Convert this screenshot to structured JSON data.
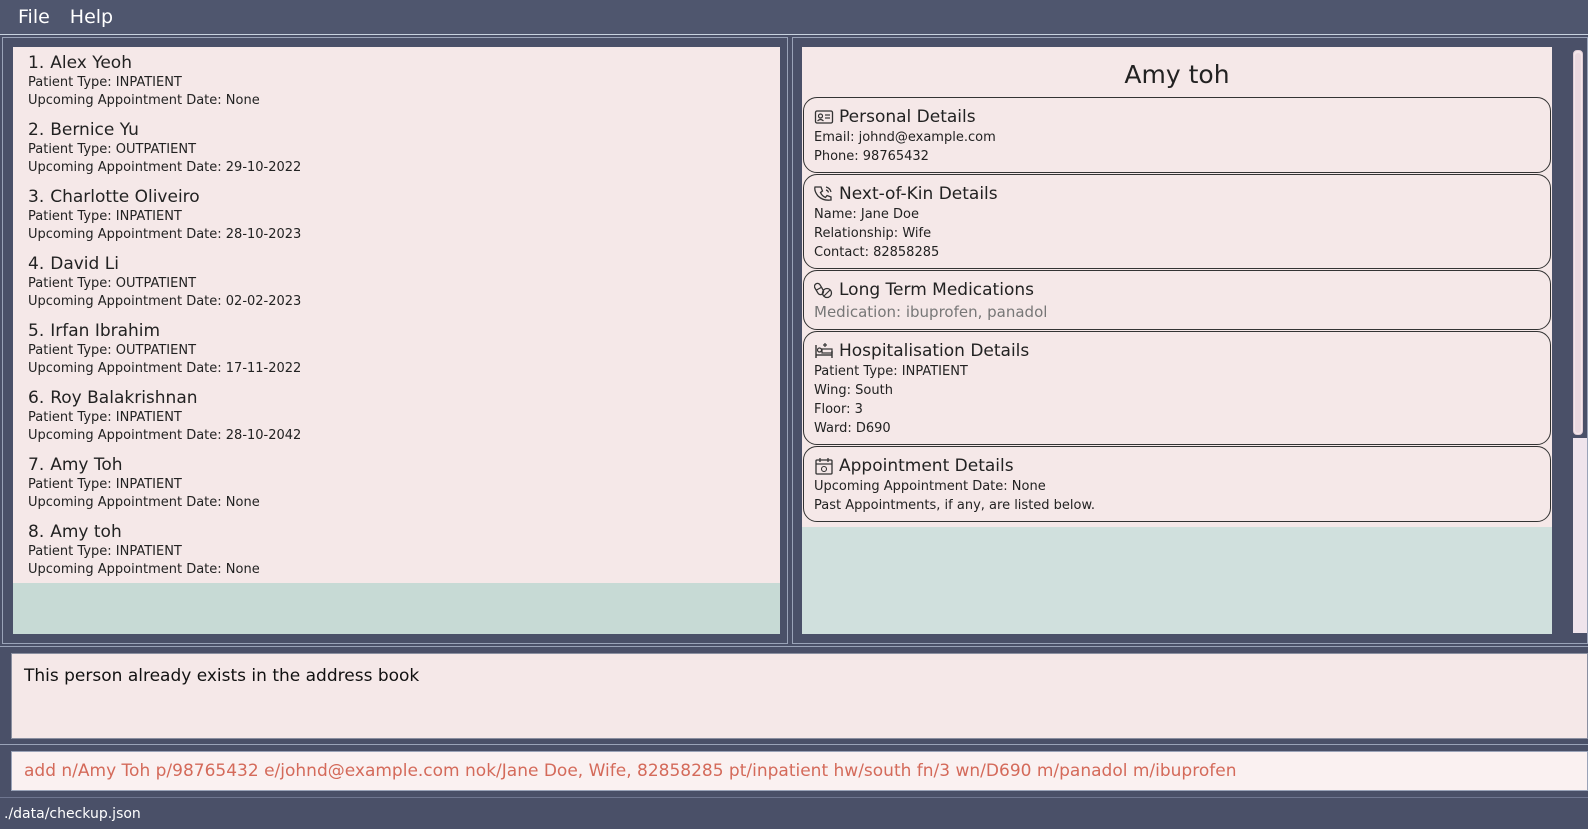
{
  "menu": {
    "file": "File",
    "help": "Help"
  },
  "patients": [
    {
      "index": "1.",
      "name": "Alex Yeoh",
      "type": "Patient Type: INPATIENT",
      "appointment": "Upcoming Appointment Date: None"
    },
    {
      "index": "2.",
      "name": "Bernice Yu",
      "type": "Patient Type: OUTPATIENT",
      "appointment": "Upcoming Appointment Date: 29-10-2022"
    },
    {
      "index": "3.",
      "name": "Charlotte Oliveiro",
      "type": "Patient Type: INPATIENT",
      "appointment": "Upcoming Appointment Date: 28-10-2023"
    },
    {
      "index": "4.",
      "name": "David Li",
      "type": "Patient Type: OUTPATIENT",
      "appointment": "Upcoming Appointment Date: 02-02-2023"
    },
    {
      "index": "5.",
      "name": "Irfan Ibrahim",
      "type": "Patient Type: OUTPATIENT",
      "appointment": "Upcoming Appointment Date: 17-11-2022"
    },
    {
      "index": "6.",
      "name": "Roy Balakrishnan",
      "type": "Patient Type: INPATIENT",
      "appointment": "Upcoming Appointment Date: 28-10-2042"
    },
    {
      "index": "7.",
      "name": "Amy Toh",
      "type": "Patient Type: INPATIENT",
      "appointment": "Upcoming Appointment Date: None"
    },
    {
      "index": "8.",
      "name": "Amy toh",
      "type": "Patient Type: INPATIENT",
      "appointment": "Upcoming Appointment Date: None"
    }
  ],
  "detail": {
    "name": "Amy toh",
    "personal": {
      "title": "Personal Details",
      "email": "Email: johnd@example.com",
      "phone": "Phone: 98765432",
      "icon": "id-card-icon"
    },
    "nok": {
      "title": "Next-of-Kin Details",
      "name": "Name: Jane Doe",
      "relationship": "Relationship: Wife",
      "contact": "Contact: 82858285",
      "icon": "phone-icon"
    },
    "medications": {
      "title": "Long Term Medications",
      "list": "Medication: ibuprofen, panadol",
      "icon": "pills-icon"
    },
    "hospitalisation": {
      "title": "Hospitalisation Details",
      "type": "Patient Type: INPATIENT",
      "wing": "Wing: South",
      "floor": "Floor: 3",
      "ward": "Ward: D690",
      "icon": "bed-icon"
    },
    "appointment": {
      "title": "Appointment Details",
      "upcoming": "Upcoming Appointment Date: None",
      "past": "Past Appointments, if any, are listed below.",
      "icon": "calendar-icon"
    }
  },
  "result": {
    "message": "This person already exists in the address book"
  },
  "command": {
    "value": "add n/Amy Toh p/98765432 e/johnd@example.com nok/Jane Doe, Wife, 82858285 pt/inpatient hw/south fn/3 wn/D690 m/panadol m/ibuprofen"
  },
  "status": {
    "path": "./data/checkup.json"
  },
  "colors": {
    "background": "#4a5068",
    "card": "#f5e8e8",
    "listEmpty": "#c7dad5",
    "commandText": "#d46a5a"
  }
}
